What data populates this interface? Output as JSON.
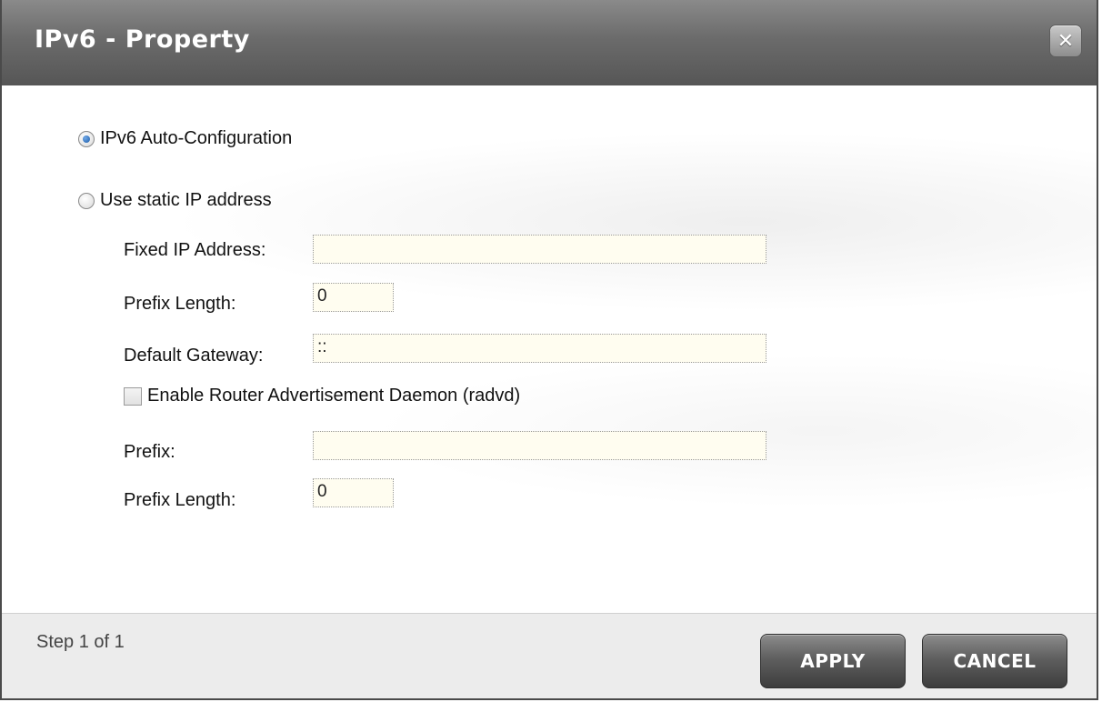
{
  "dialog": {
    "title": "IPv6 - Property",
    "close_icon": "close-icon"
  },
  "options": {
    "auto_config": {
      "label": "IPv6 Auto-Configuration",
      "selected": true
    },
    "static_ip": {
      "label": "Use static IP address",
      "selected": false
    }
  },
  "static": {
    "fixed_ip_label": "Fixed IP Address:",
    "fixed_ip_value": "",
    "prefix_length_label": "Prefix Length:",
    "prefix_length_value": "0",
    "gateway_label": "Default Gateway:",
    "gateway_value": "::",
    "radvd_label": "Enable Router Advertisement Daemon (radvd)",
    "radvd_checked": false,
    "prefix_label": "Prefix:",
    "prefix_value": "",
    "prefix_length2_label": "Prefix Length:",
    "prefix_length2_value": "0"
  },
  "footer": {
    "step_text": "Step 1 of 1",
    "apply_label": "APPLY",
    "cancel_label": "CANCEL"
  }
}
